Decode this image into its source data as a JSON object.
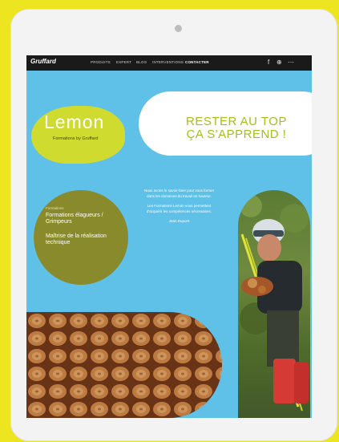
{
  "nav": {
    "logo": "Gruffard",
    "items": [
      "PRODUITS",
      "EXPERT",
      "BLOG",
      "INTERVENTIONS",
      "CONTACTER"
    ],
    "active_index": 4,
    "icons": [
      "facebook-icon",
      "globe-icon",
      "social-icon"
    ]
  },
  "lemon": {
    "title": "Lemon",
    "subtitle": "Formations by Gruffard"
  },
  "banner": {
    "line1": "RESTER AU TOP",
    "line2": "ÇA S'APPREND !"
  },
  "circle": {
    "label": "Formations",
    "item1": "Formations élagueurs / Grimpeurs",
    "item2": "Maîtrise de la réalisation technique"
  },
  "intro": {
    "paragraph1": "Nous avons le savoir-faire pour vous former dans les domaines du travail en hauteur.",
    "paragraph2": "Les Formations Lemon vous permettent d'acquérir les compétences nécessaires.",
    "sign": "Jean Dupont"
  },
  "colors": {
    "screen_bg": "#5fc0e8",
    "lemon": "#cfdb2e",
    "olive": "#898a2c",
    "accent": "#a6bd1d",
    "frame": "#ece51f"
  }
}
